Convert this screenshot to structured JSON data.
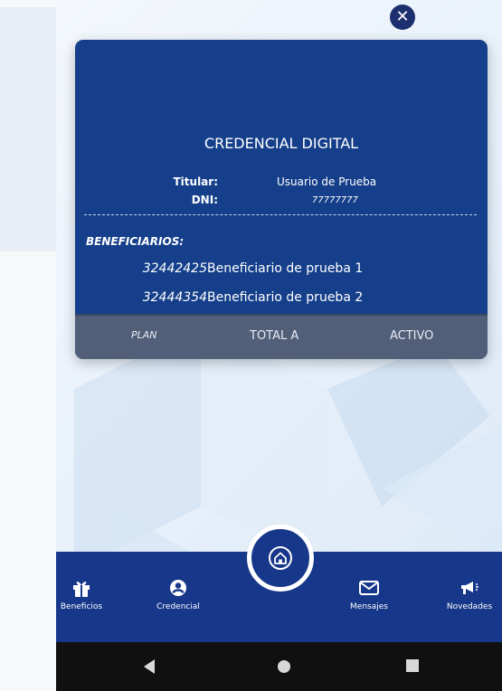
{
  "close_icon": "close-icon",
  "card": {
    "title": "CREDENCIAL DIGITAL",
    "titular_label": "Titular:",
    "titular_value": "Usuario de Prueba",
    "dni_label": "DNI:",
    "dni_value": "77777777",
    "beneficiarios_label": "BENEFICIARIOS:",
    "beneficiarios": [
      {
        "dni": "32442425",
        "name": "Beneficiario de prueba 1"
      },
      {
        "dni": "32444354",
        "name": "Beneficiario de prueba 2"
      }
    ],
    "footer": {
      "plan": "PLAN",
      "total": "TOTAL A",
      "status": "ACTIVO"
    }
  },
  "nav": {
    "items": [
      {
        "label": "Beneficios",
        "icon": "gift-icon"
      },
      {
        "label": "Credencial",
        "icon": "user-circle-icon"
      },
      {
        "label": "Mensajes",
        "icon": "envelope-icon"
      },
      {
        "label": "Novedades",
        "icon": "megaphone-icon"
      }
    ],
    "home_icon": "home-icon"
  },
  "android": {
    "back": "back-icon",
    "home": "android-home-icon",
    "recents": "recents-icon"
  },
  "colors": {
    "card": "#153f8a",
    "nav": "#16378a",
    "footer": "#525f79"
  }
}
